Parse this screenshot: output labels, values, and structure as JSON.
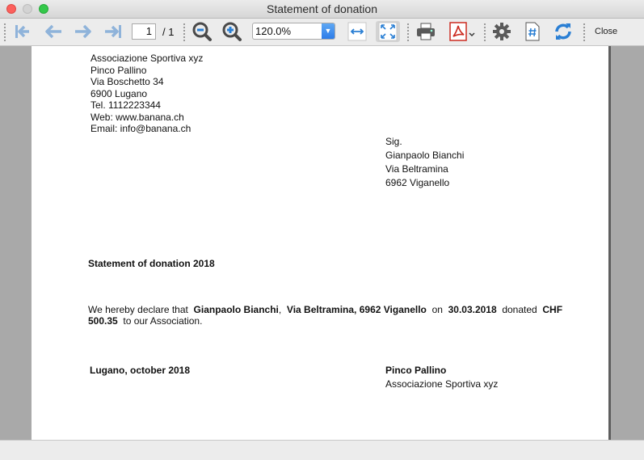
{
  "window": {
    "title": "Statement of donation"
  },
  "toolbar": {
    "page_current": "1",
    "page_total": "/ 1",
    "zoom_value": "120.0%",
    "close_label": "Close",
    "icons": [
      "first-page-icon",
      "previous-page-icon",
      "next-page-icon",
      "last-page-icon",
      "zoom-out-icon",
      "zoom-in-icon",
      "fit-width-icon",
      "fit-page-icon",
      "print-icon",
      "pdf-icon",
      "settings-icon",
      "page-number-icon",
      "refresh-icon"
    ]
  },
  "document": {
    "sender": {
      "name": "Associazione Sportiva xyz",
      "person": "Pinco Pallino",
      "street": "Via Boschetto 34",
      "city": "6900 Lugano",
      "tel": "Tel. 1112223344",
      "web": "Web: www.banana.ch",
      "email": "Email: info@banana.ch"
    },
    "recipient": {
      "salutation": "Sig.",
      "name": "Gianpaolo Bianchi",
      "street": "Via Beltramina",
      "city": "6962 Viganello"
    },
    "heading": "Statement of donation 2018",
    "body": {
      "p1": "We hereby declare that",
      "donor": "Gianpaolo Bianchi",
      "comma": ",",
      "address": "Via Beltramina, 6962 Viganello",
      "on": "on",
      "date": "30.03.2018",
      "donated": "donated",
      "currency": "CHF",
      "amount": "500.35",
      "closing": "to our Association."
    },
    "place_date": "Lugano, october 2018",
    "signatory": {
      "name": "Pinco Pallino",
      "org": "Associazione Sportiva xyz"
    }
  },
  "colors": {
    "nav_arrow": "#8fb3da",
    "toolbar_icon_blue": "#2a7fd4",
    "pdf_red": "#cc2b20",
    "page_background": "#a9a9a9"
  }
}
